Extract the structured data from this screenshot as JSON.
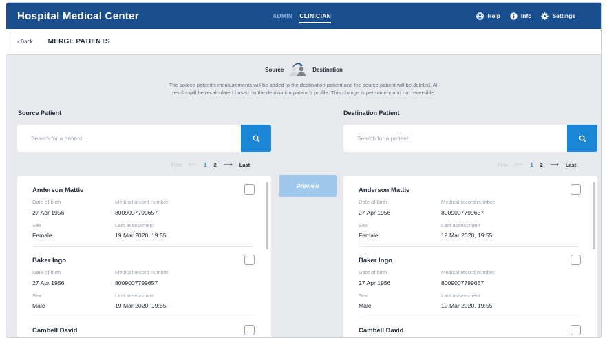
{
  "header": {
    "app_title": "Hospital Medical Center",
    "tabs": [
      {
        "label": "ADMIN",
        "active": false
      },
      {
        "label": "CLINICIAN",
        "active": true
      }
    ],
    "actions": {
      "help": "Help",
      "info": "Info",
      "settings": "Settings"
    },
    "colors": {
      "brand": "#1a4f8f",
      "accent": "#1a87d6"
    }
  },
  "subheader": {
    "back_label": "‹ Back",
    "title": "MERGE PATIENTS"
  },
  "merge": {
    "source_label": "Source",
    "destination_label": "Destination",
    "explain_line1": "The source patient's measurements will be added to the destination patient and the source patient will be deleted. All",
    "explain_line2": "results will be recalculated based on the destination patient's profile. This change is permanent and not reversible."
  },
  "source": {
    "title": "Source Patient",
    "search_placeholder": "Search for a patient...",
    "pager": {
      "first": "First",
      "pages": [
        "1",
        "2"
      ],
      "last": "Last",
      "current": "1"
    }
  },
  "destination": {
    "title": "Destination Patient",
    "search_placeholder": "Search for a patient...",
    "pager": {
      "first": "First",
      "pages": [
        "1",
        "2"
      ],
      "last": "Last",
      "current": "1"
    }
  },
  "preview_label": "Preview",
  "field_labels": {
    "dob": "Date of birth",
    "mrn": "Medical record number",
    "sex": "Sex",
    "last": "Last assessment"
  },
  "patients": [
    {
      "name": "Anderson Mattie",
      "dob": "27 Apr 1956",
      "mrn": "8009007799657",
      "sex": "Female",
      "last": "19 Mar 2020, 19:55"
    },
    {
      "name": "Baker Ingo",
      "dob": "27 Apr 1956",
      "mrn": "8009007799657",
      "sex": "Male",
      "last": "19 Mar 2020, 19:55"
    },
    {
      "name": "Cambell David"
    }
  ]
}
